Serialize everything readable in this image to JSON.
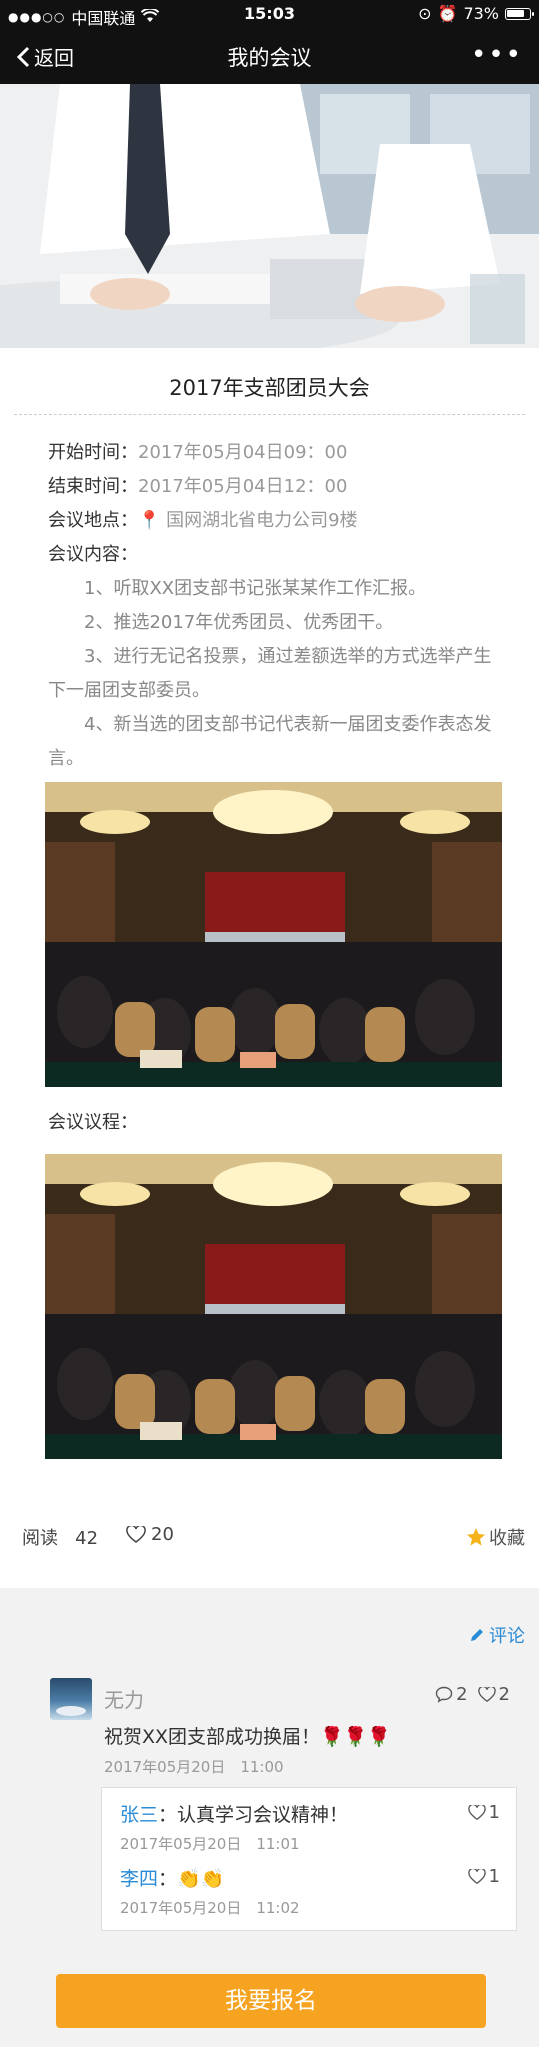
{
  "status_bar": {
    "carrier": "中国联通",
    "time": "15:03",
    "battery": "73%"
  },
  "nav": {
    "back_label": "返回",
    "title": "我的会议"
  },
  "event": {
    "title": "2017年支部团员大会",
    "start_label": "开始时间：",
    "start_value": "2017年05月04日09：00",
    "end_label": "结束时间：",
    "end_value": "2017年05月04日12：00",
    "location_label": "会议地点：",
    "location_value": "国网湖北省电力公司9楼",
    "content_label": "会议内容：",
    "content_items": [
      "1、听取XX团支部书记张某某作工作汇报。",
      "2、推选2017年优秀团员、优秀团干。",
      "3、进行无记名投票，通过差额选举的方式选举产生下一届团支部委员。",
      "4、新当选的团支部书记代表新一届团支委作表态发言。"
    ],
    "agenda_label": "会议议程："
  },
  "stats": {
    "read_label": "阅读",
    "read_count": "42",
    "like_count": "20",
    "favorite_label": "收藏"
  },
  "comments": {
    "comment_link_label": "评论",
    "items": [
      {
        "name": "无力",
        "reply_count": "2",
        "like_count": "2",
        "text": "祝贺XX团支部成功换届！🌹🌹🌹",
        "time": "2017年05月20日　11:00"
      }
    ],
    "replies": [
      {
        "name": "张三",
        "text": "：认真学习会议精神！",
        "time": "2017年05月20日　11:01",
        "likes": "1"
      },
      {
        "name": "李四",
        "text": "：👏👏",
        "time": "2017年05月20日　11:02",
        "likes": "1"
      }
    ]
  },
  "signup_button": "我要报名",
  "colors": {
    "accent_orange": "#f7a322",
    "link_blue": "#2a8bd6",
    "star": "#f5b21b",
    "nav_bg": "#111111"
  }
}
